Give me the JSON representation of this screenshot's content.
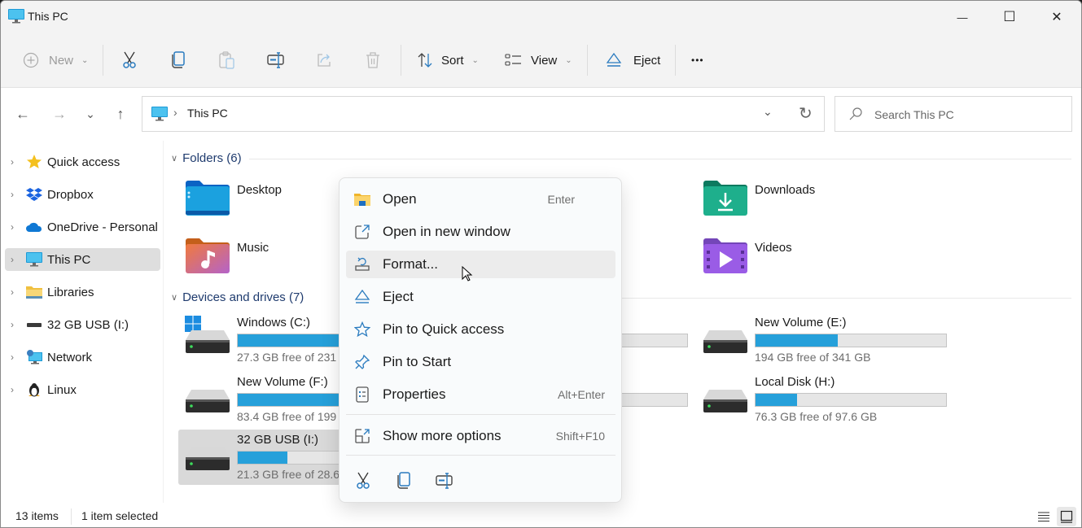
{
  "window": {
    "title": "This PC",
    "minimize_glyph": "—",
    "maximize_glyph": "☐",
    "close_glyph": "✕"
  },
  "toolbar": {
    "new_label": "New",
    "sort_label": "Sort",
    "view_label": "View",
    "eject_label": "Eject",
    "more_glyph": "•••",
    "icons": [
      "new-icon",
      "cut-icon",
      "copy-icon",
      "paste-icon",
      "rename-icon",
      "share-icon",
      "delete-icon",
      "sort-icon",
      "view-icon",
      "eject-icon",
      "more-icon"
    ]
  },
  "nav": {
    "back_glyph": "←",
    "forward_glyph": "→",
    "recent_glyph": "⌄",
    "up_glyph": "↑"
  },
  "address": {
    "separator": "›",
    "location": "This PC",
    "dropdown_glyph": "⌄",
    "refresh_glyph": "↻"
  },
  "search": {
    "placeholder": "Search This PC",
    "value": ""
  },
  "sidebar": {
    "items": [
      {
        "label": "Quick access",
        "icon": "star-icon",
        "selected": false
      },
      {
        "label": "Dropbox",
        "icon": "dropbox-icon",
        "selected": false
      },
      {
        "label": "OneDrive - Personal",
        "icon": "onedrive-icon",
        "selected": false
      },
      {
        "label": "This PC",
        "icon": "pc-icon",
        "selected": true
      },
      {
        "label": "Libraries",
        "icon": "libraries-icon",
        "selected": false
      },
      {
        "label": "32 GB USB (I:)",
        "icon": "usb-drive-icon",
        "selected": false
      },
      {
        "label": "Network",
        "icon": "network-icon",
        "selected": false
      },
      {
        "label": "Linux",
        "icon": "linux-icon",
        "selected": false
      }
    ]
  },
  "folders": {
    "header": "Folders (6)",
    "items": [
      {
        "name": "Desktop",
        "icon": "desktop-folder-icon"
      },
      {
        "name": "Downloads",
        "icon": "downloads-folder-icon"
      },
      {
        "name": "Music",
        "icon": "music-folder-icon"
      },
      {
        "name": "Videos",
        "icon": "videos-folder-icon"
      }
    ]
  },
  "drives": {
    "header": "Devices and drives (7)",
    "items": [
      {
        "name": "Windows (C:)",
        "free": "27.3 GB free of 231",
        "used_fraction": 0.88,
        "system": true,
        "selected": false
      },
      {
        "name": "New Volume (F:)",
        "free": "83.4 GB free of 199",
        "used_fraction": 0.58,
        "system": false,
        "selected": false
      },
      {
        "name": "32 GB USB (I:)",
        "free": "21.3 GB free of 28.6",
        "used_fraction": 0.26,
        "system": false,
        "selected": true
      },
      {
        "name": "",
        "free": "",
        "used_fraction": 0.0,
        "system": false,
        "selected": false
      },
      {
        "name": "",
        "free": "",
        "used_fraction": 0.24,
        "system": false,
        "selected": false
      },
      {
        "name": "New Volume (E:)",
        "free": "194 GB free of 341 GB",
        "used_fraction": 0.43,
        "system": false,
        "selected": false
      },
      {
        "name": "Local Disk (H:)",
        "free": "76.3 GB free of 97.6 GB",
        "used_fraction": 0.22,
        "system": false,
        "selected": false
      }
    ]
  },
  "context_menu": {
    "items": [
      {
        "label": "Open",
        "shortcut": "Enter",
        "icon": "folder-open-icon"
      },
      {
        "label": "Open in new window",
        "shortcut": "",
        "icon": "open-new-window-icon"
      },
      {
        "label": "Format...",
        "shortcut": "",
        "icon": "format-icon",
        "hover": true
      },
      {
        "label": "Eject",
        "shortcut": "",
        "icon": "eject-icon"
      },
      {
        "label": "Pin to Quick access",
        "shortcut": "",
        "icon": "star-outline-icon"
      },
      {
        "label": "Pin to Start",
        "shortcut": "",
        "icon": "pin-icon"
      },
      {
        "label": "Properties",
        "shortcut": "Alt+Enter",
        "icon": "properties-icon"
      },
      {
        "label": "Show more options",
        "shortcut": "Shift+F10",
        "icon": "show-more-icon"
      }
    ],
    "bottom_actions": [
      "cut-icon",
      "copy-icon",
      "rename-icon"
    ]
  },
  "status": {
    "item_count": "13 items",
    "selection": "1 item selected"
  },
  "colors": {
    "accent": "#26a0da",
    "selection": "#d9d9d9",
    "section_header": "#1f3b6e"
  }
}
